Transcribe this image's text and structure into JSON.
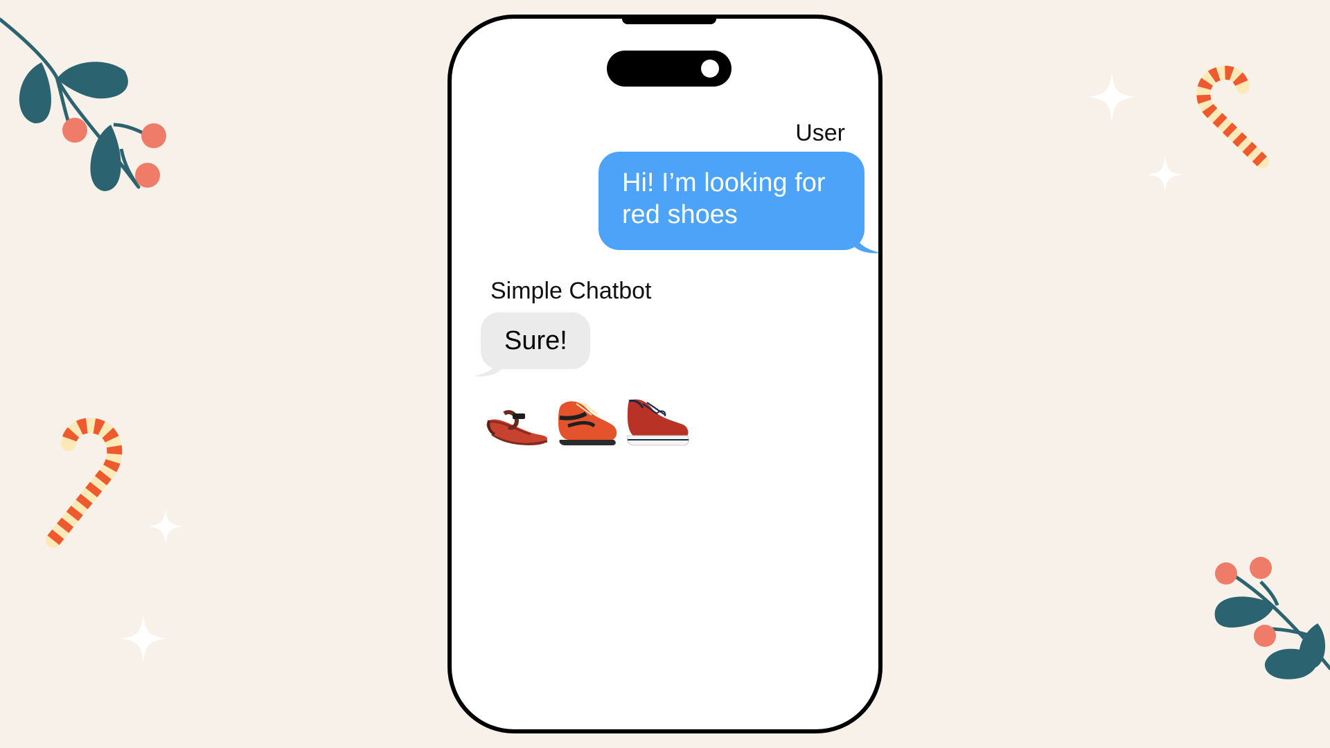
{
  "chat": {
    "user": {
      "sender_label": "User",
      "message": "Hi! I’m looking for red shoes"
    },
    "bot": {
      "sender_label": "Simple Chatbot",
      "message": "Sure!",
      "products": [
        {
          "name": "red-sandal-icon"
        },
        {
          "name": "red-sneaker-icon"
        },
        {
          "name": "red-canvas-shoe-icon"
        }
      ]
    }
  },
  "colors": {
    "background": "#f8f1ea",
    "user_bubble": "#4da3f7",
    "bot_bubble": "#ebebeb",
    "leaf": "#2b6470",
    "berry": "#ee7c68",
    "candy_red": "#ee5a2e",
    "candy_cream": "#fbe9b8"
  },
  "decorations": [
    "mistletoe-branch-icon",
    "candy-cane-icon",
    "sparkle-icon"
  ]
}
